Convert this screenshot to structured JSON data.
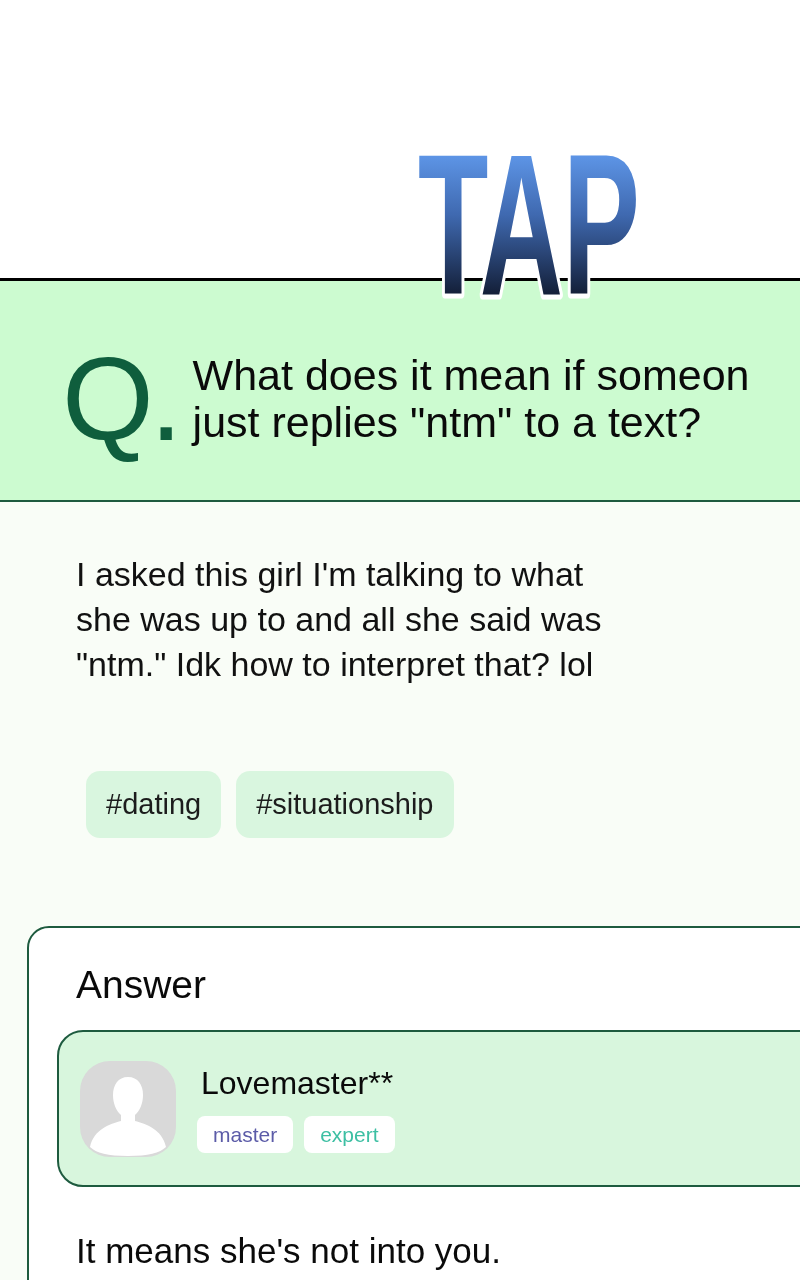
{
  "logo": {
    "text": "TAP"
  },
  "question": {
    "mark": "Q.",
    "lines": [
      "What does it mean if someon",
      "just replies \"ntm\" to a text?"
    ]
  },
  "body": {
    "lines": [
      "I asked this girl I'm talking to what",
      "she was up to and all she said was",
      "\"ntm.\" Idk how to interpret that? lol"
    ]
  },
  "tags": [
    "#dating",
    "#situationship"
  ],
  "answer": {
    "heading": "Answer",
    "author": {
      "name": "Lovemaster**",
      "badges": [
        {
          "label": "master",
          "color": "#5c5ca8"
        },
        {
          "label": "expert",
          "color": "#3dbfa3"
        }
      ]
    },
    "text": "It means she's not into you."
  }
}
